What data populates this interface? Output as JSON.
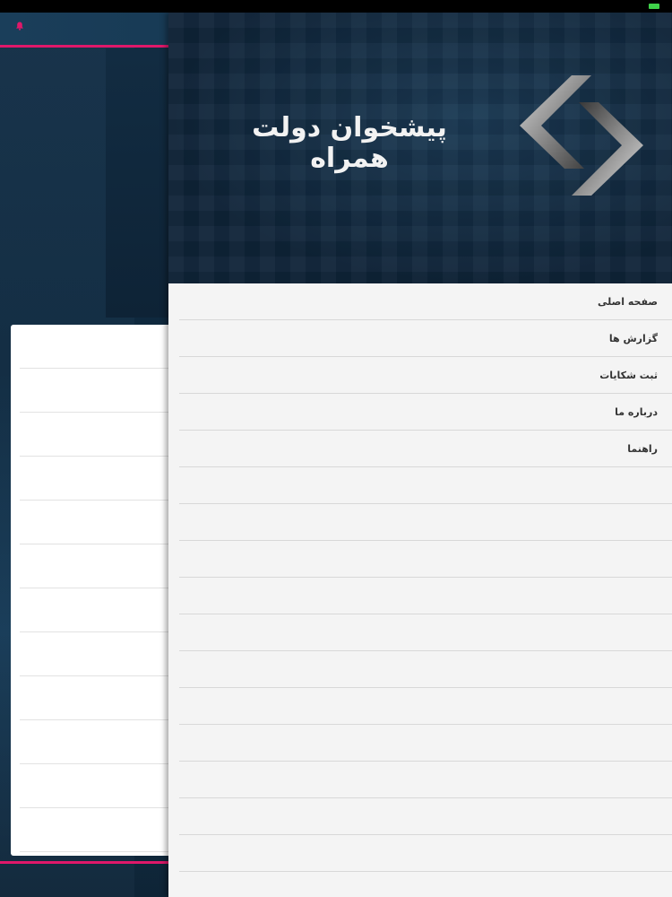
{
  "drawer": {
    "brand_title": "پیشخوان دولت همراه",
    "menu": [
      {
        "label": "صفحه اصلی"
      },
      {
        "label": "گزارش ها"
      },
      {
        "label": "ثبت شکایات"
      },
      {
        "label": "درباره ما"
      },
      {
        "label": "راهنما"
      }
    ]
  },
  "colors": {
    "accent": "#e0186a",
    "battery": "#3fd24a",
    "banner_bg": "#11283d",
    "drawer_bg": "#f4f4f4"
  },
  "icons": [
    "bell-icon",
    "app-logo-icon",
    "battery-icon"
  ]
}
